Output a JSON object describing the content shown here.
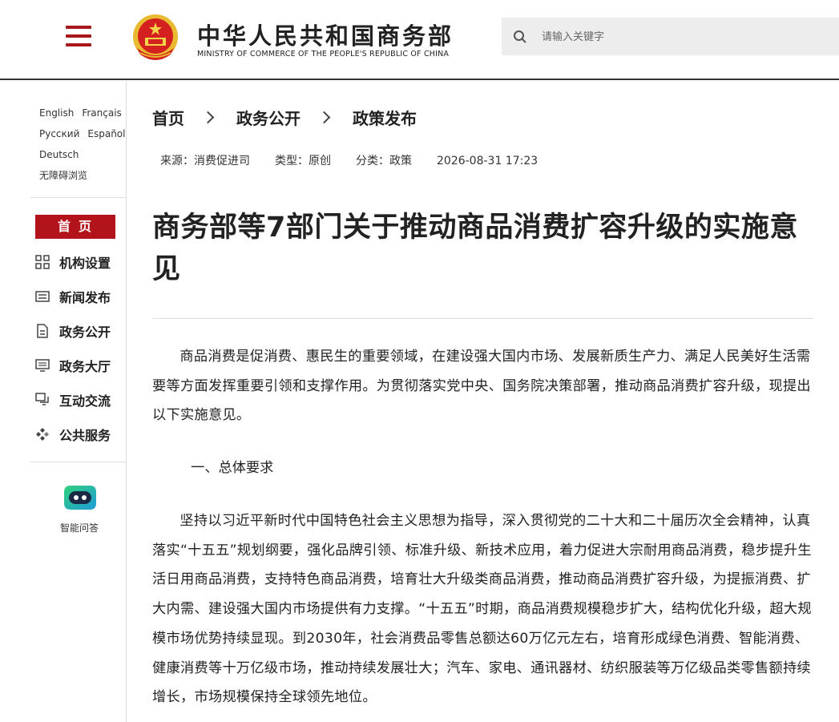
{
  "header": {
    "title": "中华人民共和国商务部",
    "subtitle": "MINISTRY OF COMMERCE OF THE PEOPLE'S REPUBLIC OF CHINA",
    "search_placeholder": "请输入关键字"
  },
  "sidebar": {
    "languages": [
      "English",
      "Français",
      "Русский",
      "Español",
      "Deutsch"
    ],
    "accessibility": "无障碍浏览",
    "home": "首页",
    "items": [
      {
        "label": "机构设置",
        "icon": "org-grid-icon"
      },
      {
        "label": "新闻发布",
        "icon": "news-icon"
      },
      {
        "label": "政务公开",
        "icon": "document-icon"
      },
      {
        "label": "政务大厅",
        "icon": "hall-icon"
      },
      {
        "label": "互动交流",
        "icon": "chat-icon"
      },
      {
        "label": "公共服务",
        "icon": "service-icon"
      }
    ],
    "assistant": "智能问答"
  },
  "breadcrumb": [
    "首页",
    "政务公开",
    "政策发布"
  ],
  "meta": {
    "source": "来源：消费促进司",
    "type": "类型：原创",
    "category": "分类：政策",
    "datetime": "2026-08-31 17:23"
  },
  "article": {
    "title": "商务部等7部门关于推动商品消费扩容升级的实施意见",
    "intro": "商品消费是促消费、惠民生的重要领域，在建设强大国内市场、发展新质生产力、满足人民美好生活需要等方面发挥重要引领和支撑作用。为贯彻落实党中央、国务院决策部署，推动商品消费扩容升级，现提出以下实施意见。",
    "section1_heading": "一、总体要求",
    "section1_body": "坚持以习近平新时代中国特色社会主义思想为指导，深入贯彻党的二十大和二十届历次全会精神，认真落实“十五五”规划纲要，强化品牌引领、标准升级、新技术应用，着力促进大宗耐用商品消费，稳步提升生活日用商品消费，支持特色商品消费，培育壮大升级类商品消费，推动商品消费扩容升级，为提振消费、扩大内需、建设强大国内市场提供有力支撑。“十五五”时期，商品消费规模稳步扩大，结构优化升级，超大规模市场优势持续显现。到2030年，社会消费品零售总额达60万亿元左右，培育形成绿色消费、智能消费、健康消费等十万亿级市场，推动持续发展壮大；汽车、家电、通讯器材、纺织服装等万亿级品类零售额持续增长，市场规模保持全球领先地位。"
  },
  "colors": {
    "brand_red": "#b3141b",
    "search_bg": "#ededed"
  }
}
